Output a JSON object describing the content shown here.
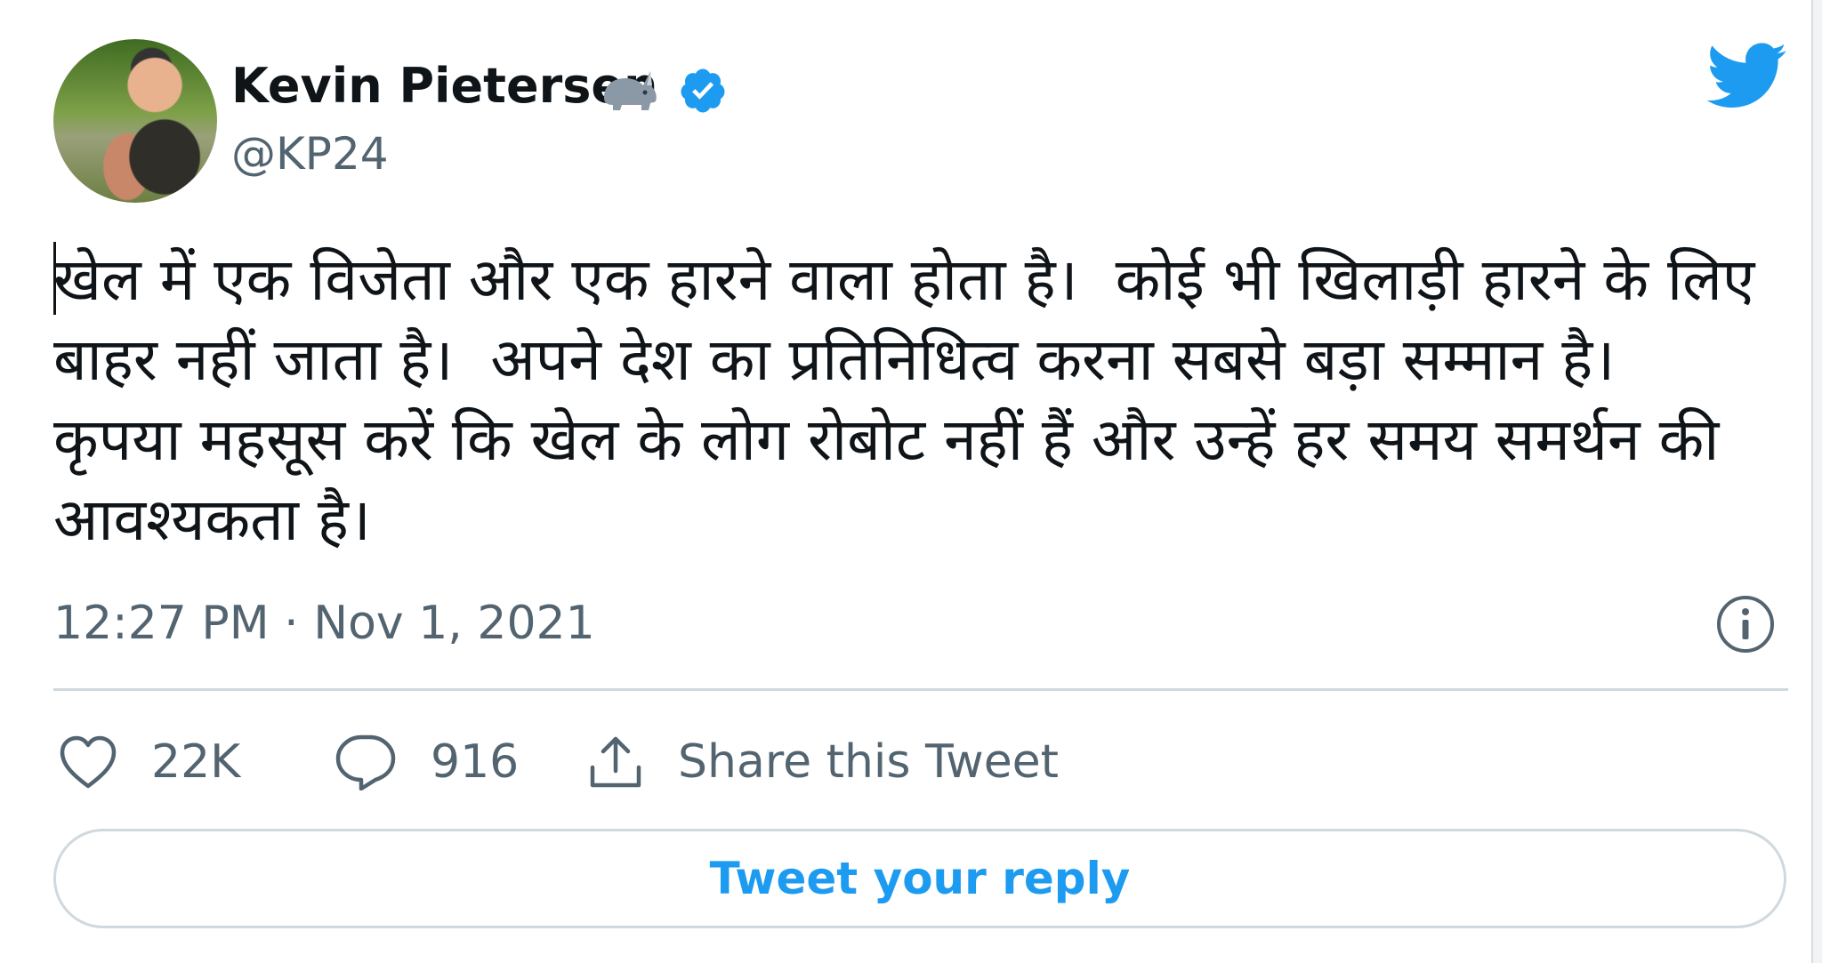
{
  "author": {
    "name": "Kevin Pietersen",
    "handle": "@KP24",
    "emoji_icon": "rhino-icon",
    "verified": true
  },
  "tweet": {
    "text": "खेल में एक विजेता और एक हारने वाला होता है।  कोई भी खिलाड़ी हारने के लिए बाहर नहीं जाता है।  अपने देश का प्रतिनिधित्व करना सबसे बड़ा सम्मान है।  कृपया महसूस करें कि खेल के लोग रोबोट नहीं हैं और उन्हें हर समय समर्थन की आवश्यकता है।",
    "timestamp": "12:27 PM · Nov 1, 2021"
  },
  "actions": {
    "like_count": "22K",
    "reply_count": "916",
    "share_label": "Share this Tweet"
  },
  "reply_button_label": "Tweet your reply",
  "colors": {
    "accent": "#1d9bf0",
    "secondary_text": "#536471",
    "border": "#cfd9de"
  }
}
